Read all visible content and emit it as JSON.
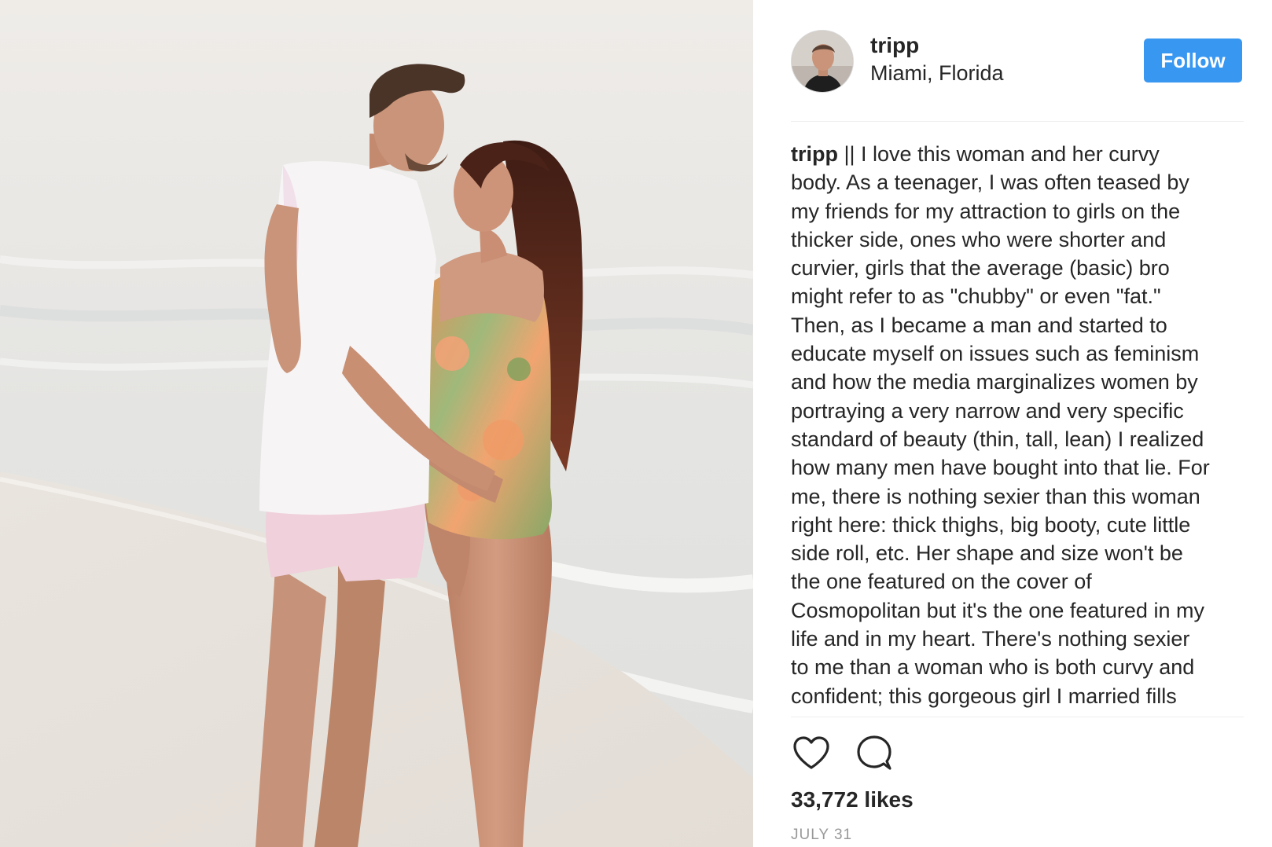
{
  "post": {
    "photo": {
      "description_icon": "photo",
      "colors": {
        "sky": "#f1eeeb",
        "sea": "#e3e3e1",
        "sand": "#e6e2dd",
        "skin": "#c98e73",
        "hair": "#5a2a1e",
        "shorts": "#f0d2dc",
        "tank": "#f6f3f6"
      }
    },
    "header": {
      "username": "tripp",
      "location": "Miami, Florida",
      "follow_label": "Follow",
      "follow_color": "#3897f0"
    },
    "caption": {
      "username": "tripp",
      "lines": [
        " || I love this woman and her curvy",
        "body. As a teenager, I was often teased by",
        "my friends for my attraction to girls on the",
        "thicker side, ones who were shorter and",
        "curvier, girls that the average (basic) bro",
        "might refer to as \"chubby\" or even \"fat.\"",
        "Then, as I became a man and started to",
        "educate myself on issues such as feminism",
        "and how the media marginalizes women by",
        "portraying a very narrow and very specific",
        "standard of beauty (thin, tall, lean) I realized",
        "how many men have bought into that lie. For",
        "me, there is nothing sexier than this woman",
        "right here: thick thighs, big booty, cute little",
        "side roll, etc. Her shape and size won't be",
        "the one featured on the cover of",
        "Cosmopolitan but it's the one featured in my",
        "life and in my heart. There's nothing sexier",
        "to me than a woman who is both curvy and",
        "confident; this gorgeous girl I married fills"
      ]
    },
    "actions": {
      "like_icon": "heart-icon",
      "comment_icon": "comment-icon"
    },
    "likes": "33,772 likes",
    "date": "JULY 31"
  }
}
